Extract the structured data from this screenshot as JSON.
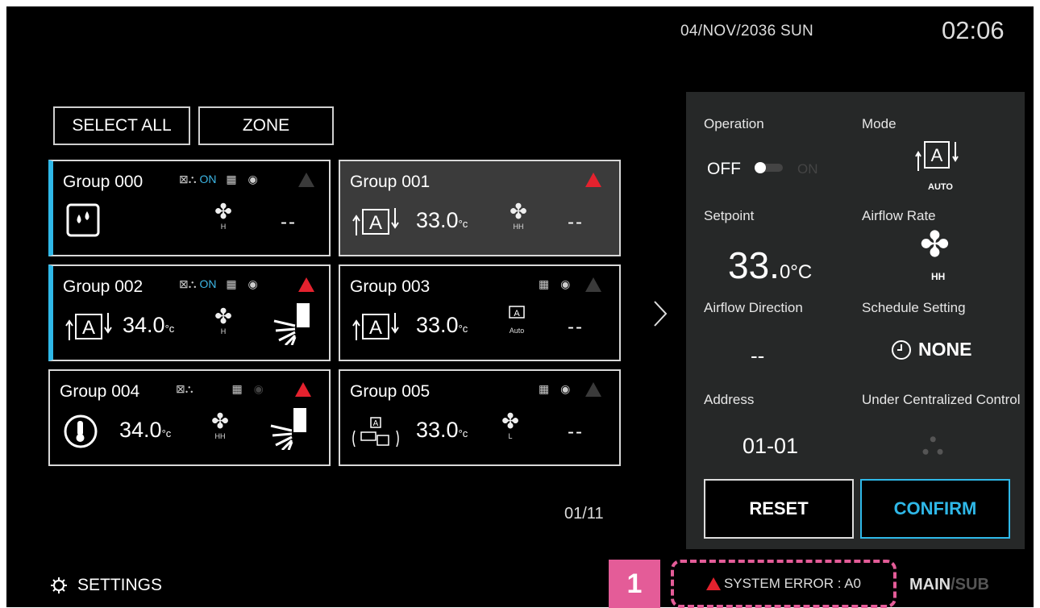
{
  "header": {
    "date": "04/NOV/2036  SUN",
    "time": "02:06"
  },
  "toolbar": {
    "select_all": "SELECT ALL",
    "zone": "ZONE"
  },
  "groups": [
    {
      "name": "Group 000",
      "on_label": "ON",
      "temp": "",
      "fan_level": "H",
      "direction": "--",
      "error": false
    },
    {
      "name": "Group 001",
      "on_label": "",
      "temp": "33.0",
      "fan_level": "HH",
      "direction": "--",
      "error": true
    },
    {
      "name": "Group 002",
      "on_label": "ON",
      "temp": "34.0",
      "fan_level": "H",
      "direction": "",
      "error": true
    },
    {
      "name": "Group 003",
      "on_label": "",
      "temp": "33.0",
      "fan_level": "Auto",
      "direction": "--",
      "error": false
    },
    {
      "name": "Group 004",
      "on_label": "",
      "temp": "34.0",
      "fan_level": "HH",
      "direction": "",
      "error": true
    },
    {
      "name": "Group 005",
      "on_label": "",
      "temp": "33.0",
      "fan_level": "L",
      "direction": "--",
      "error": false
    }
  ],
  "temp_unit": "°c",
  "pagination": {
    "page": "01/11"
  },
  "panel": {
    "operation_label": "Operation",
    "off_label": "OFF",
    "on_label": "ON",
    "mode_label": "Mode",
    "mode_value": "AUTO",
    "setpoint_label": "Setpoint",
    "setpoint_value": "33.",
    "setpoint_decimal": "0°C",
    "airflow_rate_label": "Airflow Rate",
    "airflow_rate_value": "HH",
    "airflow_direction_label": "Airflow Direction",
    "airflow_direction_value": "--",
    "schedule_label": "Schedule Setting",
    "schedule_value": "NONE",
    "address_label": "Address",
    "address_value": "01-01",
    "centralized_label": "Under Centralized Control",
    "reset": "RESET",
    "confirm": "CONFIRM"
  },
  "footer": {
    "settings": "SETTINGS",
    "callout_number": "1",
    "error_text": "SYSTEM ERROR : A0",
    "main": "MAIN",
    "sub": "SUB"
  },
  "colors": {
    "accent": "#2fb8e8",
    "error": "#e4222e",
    "callout": "#e45c98",
    "panel": "#262828"
  }
}
